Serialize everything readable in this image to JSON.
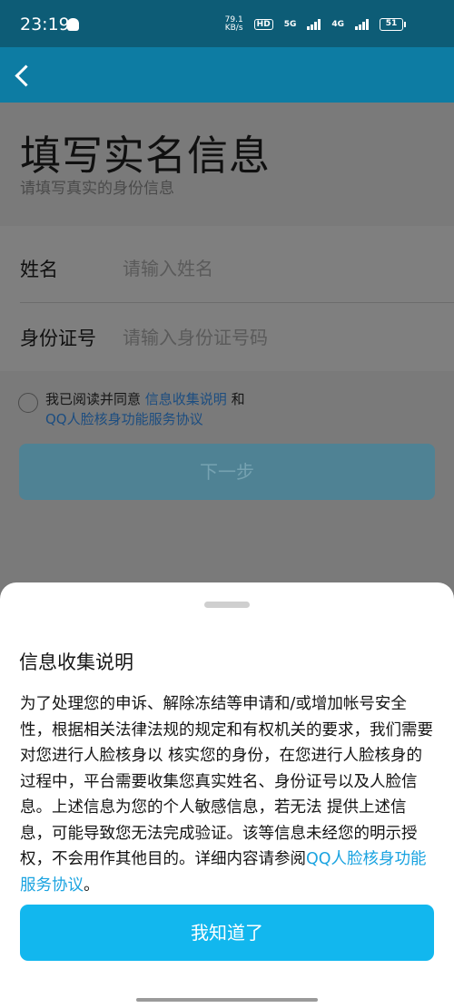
{
  "status_bar": {
    "time": "23:19",
    "net_speed_value": "79.1",
    "net_speed_unit": "KB/s",
    "hd_label": "HD",
    "net1": "5G",
    "net2": "4G",
    "battery": "51"
  },
  "page": {
    "title": "填写实名信息",
    "subtitle": "请填写真实的身份信息",
    "fields": [
      {
        "label": "姓名",
        "placeholder": "请输入姓名",
        "value": ""
      },
      {
        "label": "身份证号",
        "placeholder": "请输入身份证号码",
        "value": ""
      }
    ],
    "agreement": {
      "prefix": "我已阅读并同意 ",
      "link1": "信息收集说明",
      "conj": " 和",
      "link2": "QQ人脸核身功能服务协议"
    },
    "next_button": "下一步"
  },
  "sheet": {
    "title": "信息收集说明",
    "body": "为了处理您的申诉、解除冻结等申请和/或增加帐号安全性，根据相关法律法规的规定和有权机关的要求，我们需要对您进行人脸核身以 核实您的身份，在您进行人脸核身的过程中，平台需要收集您真实姓名、身份证号以及人脸信息。上述信息为您的个人敏感信息，若无法 提供上述信息，可能导致您无法完成验证。该等信息未经您的明示授权，不会用作其他目的。详细内容请参阅",
    "link": "QQ人脸核身功能服务协议",
    "end": "。",
    "ok_button": "我知道了"
  },
  "colors": {
    "header": "#0d7ca3",
    "status_bar": "#0d5c76",
    "accent": "#12b7ee",
    "link": "#1aa3e0"
  }
}
